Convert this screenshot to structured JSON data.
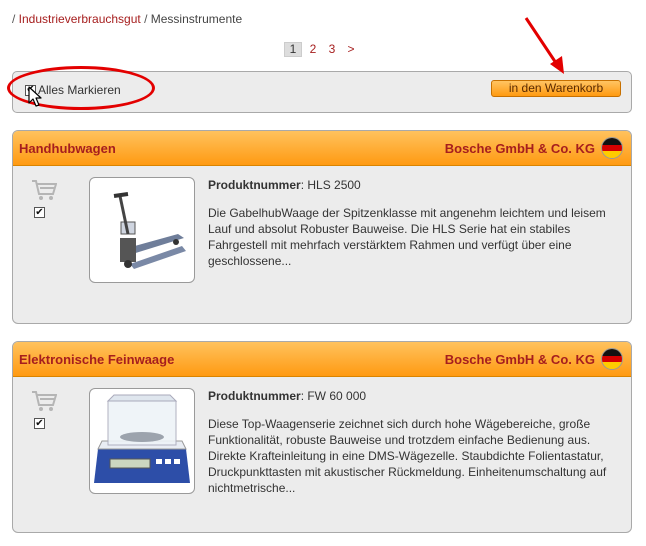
{
  "breadcrumb": {
    "sep1": "/ ",
    "link": "Industrieverbrauchsgut",
    "sep2": " / ",
    "current": "Messinstrumente"
  },
  "pager": {
    "p1": "1",
    "p2": "2",
    "p3": "3",
    "next": ">"
  },
  "toolbar": {
    "mark_all_label": "Alles Markieren",
    "cart_button": "in den Warenkorb"
  },
  "products": [
    {
      "title": "Handhubwagen",
      "company": "Bosche GmbH & Co. KG",
      "pn_label": "Produktnummer",
      "pn_value": ": HLS 2500",
      "description": "Die GabelhubWaage der Spitzenklasse mit angenehm leichtem und leisem Lauf und absolut Robuster Bauweise. Die HLS Serie hat ein stabiles Fahrgestell mit mehrfach verstärktem Rahmen und verfügt über eine geschlossene..."
    },
    {
      "title": "Elektronische Feinwaage",
      "company": "Bosche GmbH & Co. KG",
      "pn_label": "Produktnummer",
      "pn_value": ": FW 60 000",
      "description": "Diese Top-Waagenserie zeichnet sich durch hohe Wägebereiche, große Funktionalität, robuste Bauweise und trotzdem einfache Bedienung aus. Direkte Krafteinleitung in eine DMS-Wägezelle. Staubdichte Folientastatur, Druckpunkttasten mit akustischer Rückmeldung. Einheitenumschaltung auf nichtmetrische..."
    }
  ],
  "colors": {
    "accent_red": "#a61e1e",
    "header_orange": "#ff9a12",
    "annotation_red": "#e30000"
  },
  "icons": [
    "cart-icon",
    "germany-flag-icon",
    "mouse-pointer-icon",
    "annotation-arrow",
    "annotation-ellipse"
  ]
}
